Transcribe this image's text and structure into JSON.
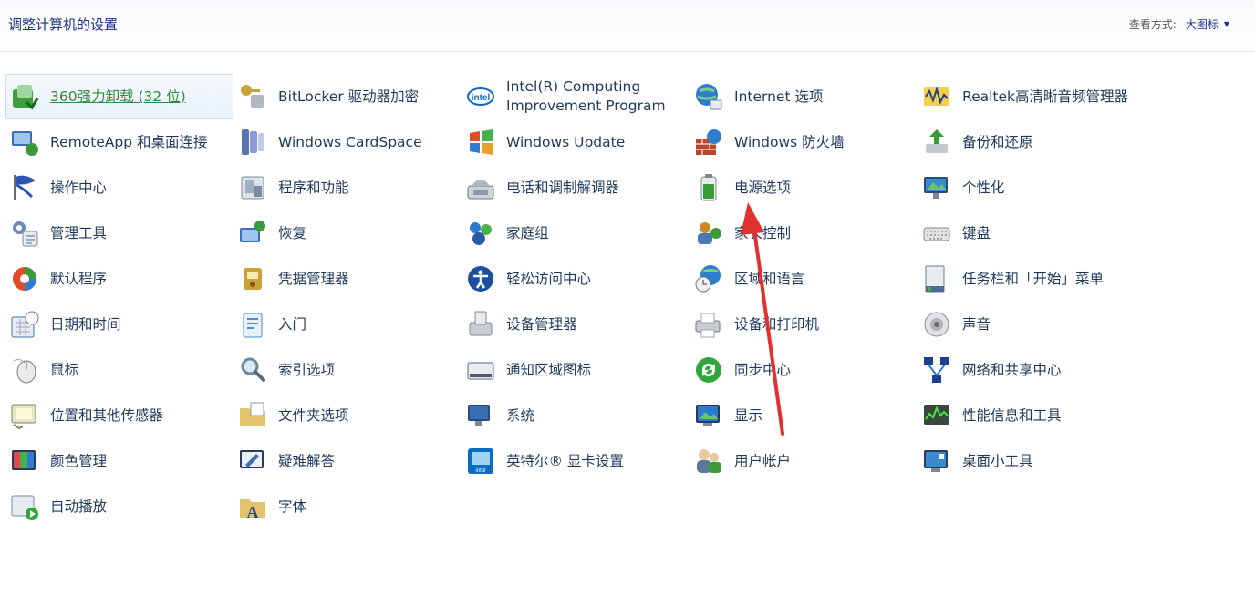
{
  "header": {
    "title": "调整计算机的设置",
    "view_label": "查看方式:",
    "view_value": "大图标"
  },
  "items": [
    {
      "label": "360强力卸载 (32 位)",
      "icon": "uninstall-icon",
      "color": "#3aa03a"
    },
    {
      "label": "BitLocker 驱动器加密",
      "icon": "key-lock-icon",
      "color": "#c9a23a"
    },
    {
      "label": "Intel(R) Computing Improvement Program",
      "icon": "intel-icon",
      "color": "#0a6cc4"
    },
    {
      "label": "Internet 选项",
      "icon": "globe-icon",
      "color": "#2f7dd1"
    },
    {
      "label": "Realtek高清晰音频管理器",
      "icon": "audio-wave-icon",
      "color": "#1d3f8f"
    },
    {
      "label": "RemoteApp 和桌面连接",
      "icon": "remote-desktop-icon",
      "color": "#3a6fb5"
    },
    {
      "label": "Windows CardSpace",
      "icon": "cardspace-icon",
      "color": "#5b73b8"
    },
    {
      "label": "Windows Update",
      "icon": "windows-update-icon",
      "color": "#e8a12a"
    },
    {
      "label": "Windows 防火墙",
      "icon": "firewall-icon",
      "color": "#b5452c"
    },
    {
      "label": "备份和还原",
      "icon": "backup-icon",
      "color": "#3a9a3a"
    },
    {
      "label": "操作中心",
      "icon": "flag-icon",
      "color": "#2a56b5"
    },
    {
      "label": "程序和功能",
      "icon": "programs-icon",
      "color": "#7a8aa0"
    },
    {
      "label": "电话和调制解调器",
      "icon": "phone-icon",
      "color": "#6a7a8a"
    },
    {
      "label": "电源选项",
      "icon": "battery-icon",
      "color": "#3a9a3a"
    },
    {
      "label": "个性化",
      "icon": "personalize-icon",
      "color": "#3a8ad1"
    },
    {
      "label": "管理工具",
      "icon": "admin-tools-icon",
      "color": "#6a8ab0"
    },
    {
      "label": "恢复",
      "icon": "recovery-icon",
      "color": "#3a6fb5"
    },
    {
      "label": "家庭组",
      "icon": "homegroup-icon",
      "color": "#2a7ad1"
    },
    {
      "label": "家长控制",
      "icon": "parental-control-icon",
      "color": "#c98a2a"
    },
    {
      "label": "键盘",
      "icon": "keyboard-icon",
      "color": "#8a8a8a"
    },
    {
      "label": "默认程序",
      "icon": "default-programs-icon",
      "color": "#3a9a3a"
    },
    {
      "label": "凭据管理器",
      "icon": "credential-icon",
      "color": "#c9a23a"
    },
    {
      "label": "轻松访问中心",
      "icon": "ease-of-access-icon",
      "color": "#1d4f9f"
    },
    {
      "label": "区域和语言",
      "icon": "region-clock-icon",
      "color": "#2f7dd1"
    },
    {
      "label": "任务栏和「开始」菜单",
      "icon": "taskbar-icon",
      "color": "#6a7a8a"
    },
    {
      "label": "日期和时间",
      "icon": "calendar-clock-icon",
      "color": "#3a6fb5"
    },
    {
      "label": "入门",
      "icon": "getting-started-icon",
      "color": "#4a8ad1"
    },
    {
      "label": "设备管理器",
      "icon": "device-manager-icon",
      "color": "#7a8a9a"
    },
    {
      "label": "设备和打印机",
      "icon": "printer-icon",
      "color": "#6a7a8a"
    },
    {
      "label": "声音",
      "icon": "speaker-icon",
      "color": "#8a8a8a"
    },
    {
      "label": "鼠标",
      "icon": "mouse-icon",
      "color": "#7a7a7a"
    },
    {
      "label": "索引选项",
      "icon": "magnifier-icon",
      "color": "#6a8aa0"
    },
    {
      "label": "通知区域图标",
      "icon": "notification-tray-icon",
      "color": "#5a6a7a"
    },
    {
      "label": "同步中心",
      "icon": "sync-icon",
      "color": "#2ea83a"
    },
    {
      "label": "网络和共享中心",
      "icon": "network-icon",
      "color": "#1d3f8f"
    },
    {
      "label": "位置和其他传感器",
      "icon": "sensor-icon",
      "color": "#7a8a5a"
    },
    {
      "label": "文件夹选项",
      "icon": "folder-options-icon",
      "color": "#e2c26a"
    },
    {
      "label": "系统",
      "icon": "system-icon",
      "color": "#3a6fb5"
    },
    {
      "label": "显示",
      "icon": "display-icon",
      "color": "#2a7ad1"
    },
    {
      "label": "性能信息和工具",
      "icon": "performance-icon",
      "color": "#3a4a3a"
    },
    {
      "label": "颜色管理",
      "icon": "color-management-icon",
      "color": "#e24a4a"
    },
    {
      "label": "疑难解答",
      "icon": "troubleshoot-icon",
      "color": "#3a6fb5"
    },
    {
      "label": "英特尔® 显卡设置",
      "icon": "intel-graphics-icon",
      "color": "#0a6cc4"
    },
    {
      "label": "用户帐户",
      "icon": "user-accounts-icon",
      "color": "#5a7a9a"
    },
    {
      "label": "桌面小工具",
      "icon": "gadgets-icon",
      "color": "#3a8ad1"
    },
    {
      "label": "自动播放",
      "icon": "autoplay-icon",
      "color": "#2ea83a"
    },
    {
      "label": "字体",
      "icon": "fonts-icon",
      "color": "#e2c26a"
    }
  ],
  "annotation_color": "#e03030"
}
